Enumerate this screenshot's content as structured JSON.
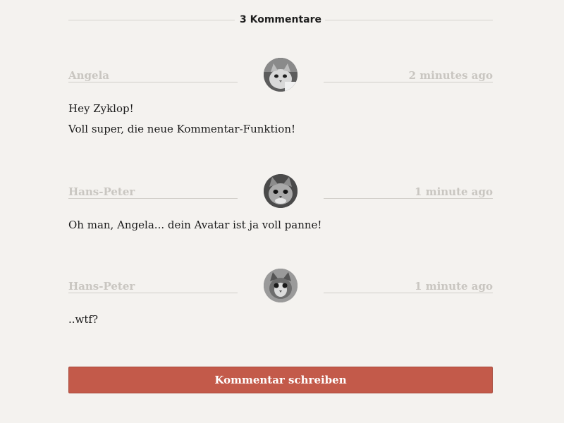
{
  "comments_header": {
    "title": "3 Kommentare"
  },
  "comments": [
    {
      "author": "Angela",
      "time": "2 minutes ago",
      "avatar_icon": "kitten-avatar-icon",
      "paragraphs": [
        "Hey Zyklop!",
        "Voll super, die neue Kommentar-Funktion!"
      ]
    },
    {
      "author": "Hans-Peter",
      "time": "1 minute ago",
      "avatar_icon": "kitten-avatar-icon",
      "paragraphs": [
        "Oh man, Angela... dein Avatar ist ja voll panne!"
      ]
    },
    {
      "author": "Hans-Peter",
      "time": "1 minute ago",
      "avatar_icon": "kitten-avatar-icon",
      "paragraphs": [
        "..wtf?"
      ]
    }
  ],
  "write_button": {
    "label": "Kommentar schreiben"
  },
  "colors": {
    "background": "#f4f2ef",
    "button": "#c35a4a",
    "muted_text": "#c9c6c1",
    "rule": "#d6d3cf"
  }
}
